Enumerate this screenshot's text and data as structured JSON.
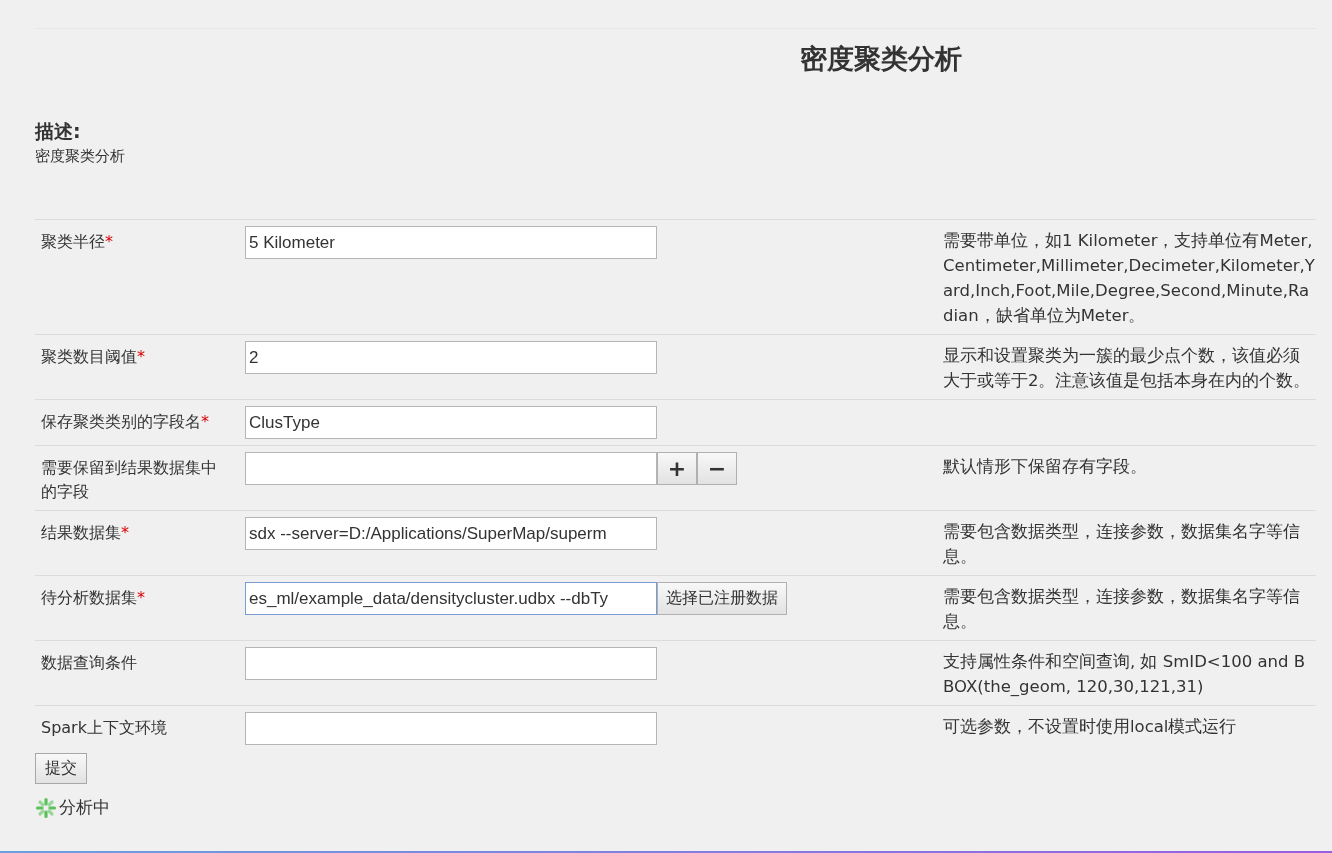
{
  "title": "密度聚类分析",
  "description": {
    "heading": "描述:",
    "text": "密度聚类分析"
  },
  "params": [
    {
      "kind": "plain",
      "label": "聚类半径",
      "required_mark": "*",
      "value": "5 Kilometer",
      "focused": false,
      "hint": "需要带单位，如1 Kilometer，支持单位有Meter,Centimeter,Millimeter,Decimeter,Kilometer,Yard,Inch,Foot,Mile,Degree,Second,Minute,Radian，缺省单位为Meter。"
    },
    {
      "kind": "plain",
      "label": "聚类数目阈值",
      "required_mark": "*",
      "value": "2",
      "focused": false,
      "hint": "显示和设置聚类为一簇的最少点个数，该值必须大于或等于2。注意该值是包括本身在内的个数。"
    },
    {
      "kind": "plain",
      "label": "保存聚类类别的字段名",
      "required_mark": "*",
      "value": "ClusType",
      "focused": false
    },
    {
      "kind": "add-remove",
      "label": "需要保留到结果数据集中的字段",
      "focused": false,
      "add": "+",
      "remove": "−",
      "hint": "默认情形下保留存有字段。"
    },
    {
      "kind": "plain",
      "label": "结果数据集",
      "required_mark": "*",
      "value": "sdx --server=D:/Applications/SuperMap/superm",
      "focused": false,
      "hint": "需要包含数据类型，连接参数，数据集名字等信息。"
    },
    {
      "kind": "picker",
      "label": "待分析数据集",
      "required_mark": "*",
      "value": "es_ml/example_data/densitycluster.udbx --dbTy",
      "focused": true,
      "button": "选择已注册数据",
      "hint": "需要包含数据类型，连接参数，数据集名字等信息。"
    },
    {
      "kind": "plain",
      "label": "数据查询条件",
      "focused": false,
      "hint": "支持属性条件和空间查询, 如 SmID<100 and BBOX(the_geom, 120,30,121,31)"
    },
    {
      "kind": "plain",
      "label": "Spark上下文环境",
      "focused": false,
      "hint": "可选参数，不设置时使用local模式运行"
    }
  ],
  "submit": "提交",
  "status": "分析中"
}
